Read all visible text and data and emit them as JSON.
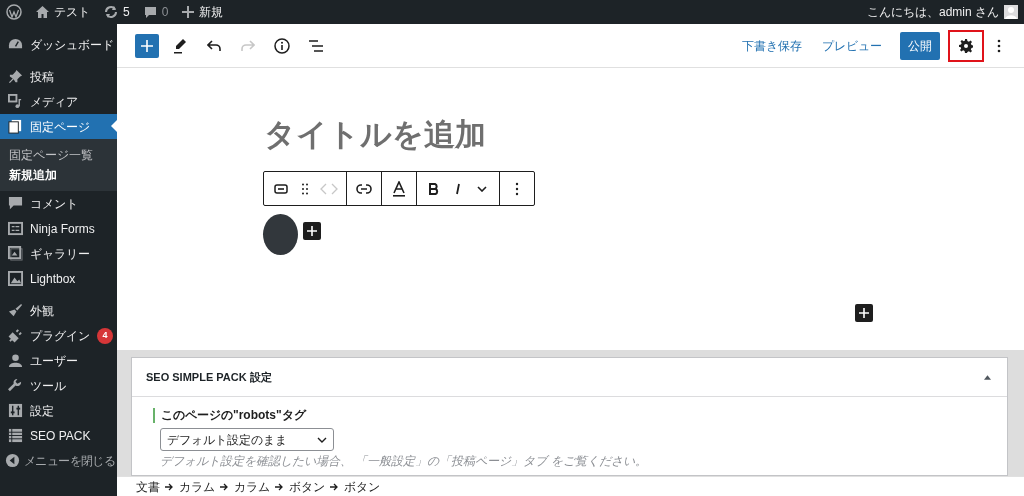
{
  "admin_bar": {
    "site": "テスト",
    "updates": "5",
    "comments": "0",
    "new": "新規",
    "greeting": "こんにちは、admin さん"
  },
  "sidebar": {
    "items": [
      {
        "kind": "item",
        "label": "ダッシュボード",
        "selected": false
      },
      {
        "kind": "separator"
      },
      {
        "kind": "item",
        "label": "投稿",
        "selected": false
      },
      {
        "kind": "item",
        "label": "メディア",
        "selected": false
      },
      {
        "kind": "item",
        "label": "固定ページ",
        "selected": true,
        "children": [
          {
            "label": "固定ページ一覧",
            "selected": false
          },
          {
            "label": "新規追加",
            "selected": true
          }
        ]
      },
      {
        "kind": "item",
        "label": "コメント",
        "selected": false
      },
      {
        "kind": "item",
        "label": "Ninja Forms",
        "selected": false
      },
      {
        "kind": "item",
        "label": "ギャラリー",
        "selected": false
      },
      {
        "kind": "item",
        "label": "Lightbox",
        "selected": false
      },
      {
        "kind": "separator"
      },
      {
        "kind": "item",
        "label": "外観",
        "selected": false
      },
      {
        "kind": "item",
        "label": "プラグイン",
        "selected": false,
        "badge": "4"
      },
      {
        "kind": "item",
        "label": "ユーザー",
        "selected": false
      },
      {
        "kind": "item",
        "label": "ツール",
        "selected": false
      },
      {
        "kind": "item",
        "label": "設定",
        "selected": false
      },
      {
        "kind": "item",
        "label": "SEO PACK",
        "selected": false
      },
      {
        "kind": "collapse",
        "label": "メニューを閉じる"
      }
    ]
  },
  "toolbar": {
    "redo_disabled": true,
    "settings_highlighted": true,
    "buttons": [
      {
        "kind": "link",
        "label": "下書き保存"
      },
      {
        "kind": "link",
        "label": "プレビュー"
      },
      {
        "kind": "primary",
        "label": "公開"
      }
    ]
  },
  "editor": {
    "title_placeholder": "タイトルを追加"
  },
  "metabox": {
    "title": "SEO SIMPLE PACK 設定",
    "expanded": true,
    "field_label": "このページの\"robots\"タグ",
    "select_value": "デフォルト設定のまま",
    "hint": "デフォルト設定を確認したい場合、",
    "hint_link": "「一般設定」の「投稿ページ」タブ",
    "hint_after": "をご覧ください。"
  },
  "breadcrumbs": [
    "文書",
    "カラム",
    "カラム",
    "ボタン",
    "ボタン"
  ]
}
